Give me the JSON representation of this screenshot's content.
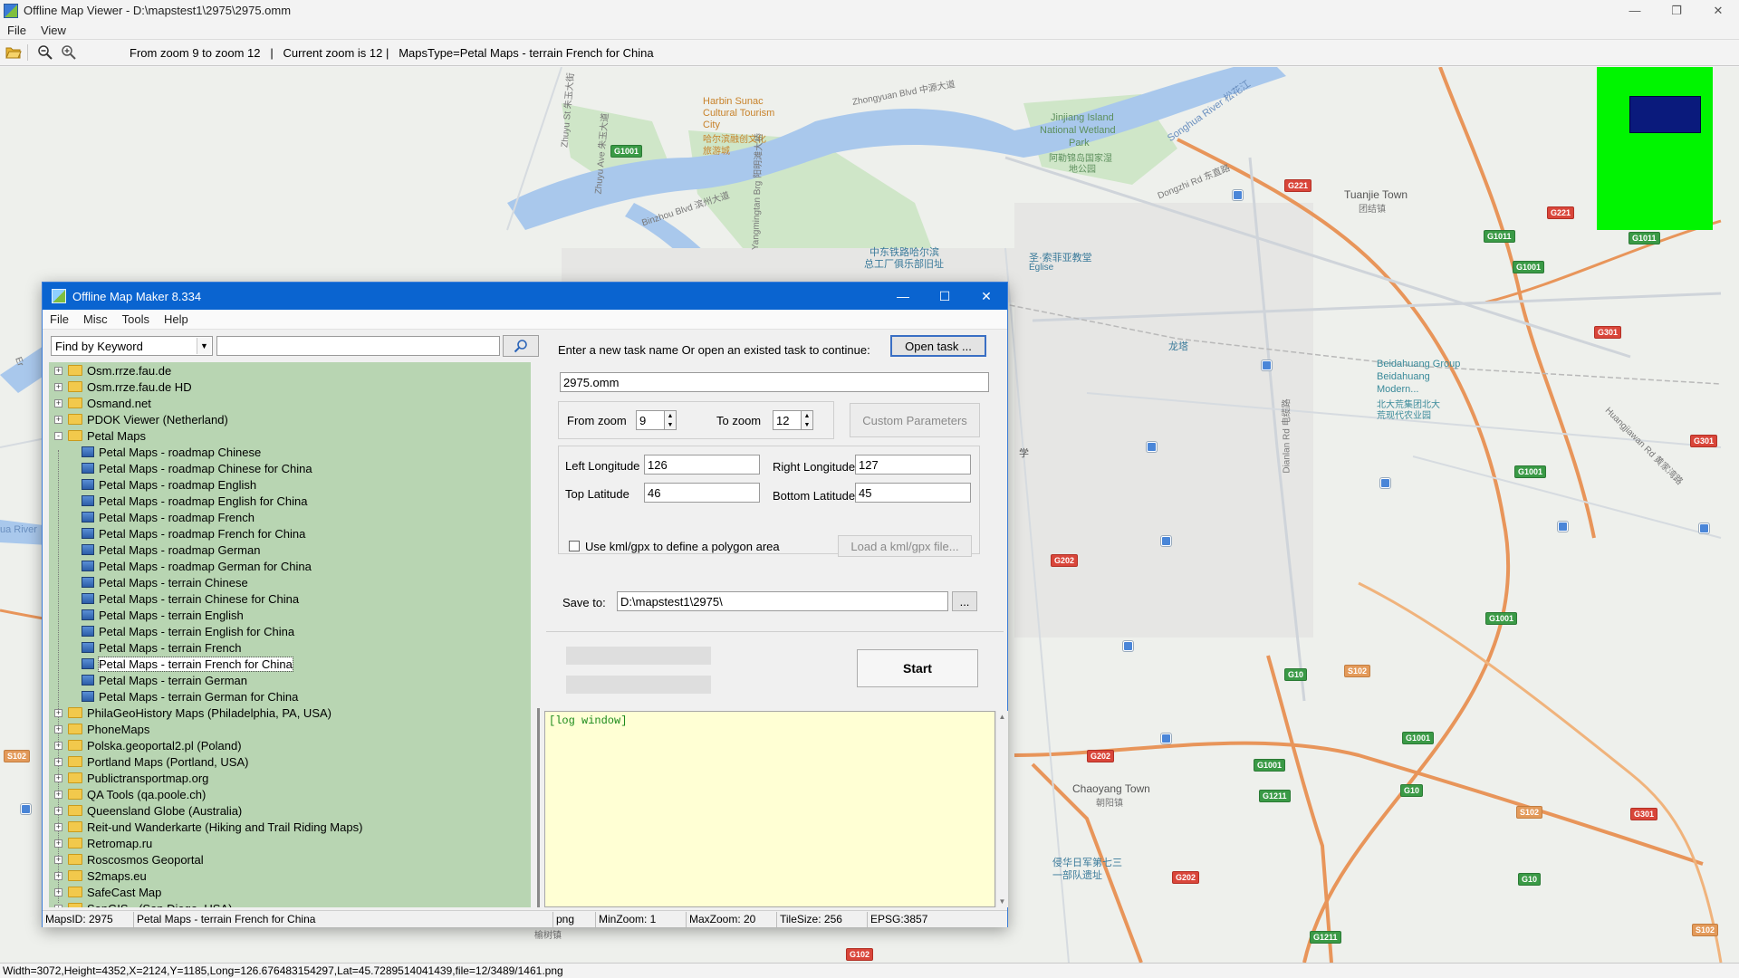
{
  "viewer": {
    "title": "Offline Map Viewer - D:\\mapstest1\\2975\\2975.omm",
    "menu": [
      "File",
      "View"
    ],
    "toolbar_status": "From zoom 9 to zoom 12   |   Current zoom is 12 |   MapsType=Petal Maps - terrain French for China",
    "statusbar": "Width=3072,Height=4352,X=2124,Y=1185,Long=126.676483154297,Lat=45.7289514041439,file=12/3489/1461.png",
    "icons": [
      "folder-open-icon",
      "zoom-out-icon",
      "zoom-in-icon"
    ]
  },
  "map": {
    "labels": [
      {
        "text": "Harbin Sunac",
        "color": "#c8822a"
      },
      {
        "text": "Cultural Tourism",
        "color": "#c8822a"
      },
      {
        "text": "City",
        "color": "#c8822a"
      },
      {
        "text": "哈尔滨融创文化",
        "color": "#c8822a"
      },
      {
        "text": "旅游城",
        "color": "#c8822a"
      },
      {
        "text": "Jinjiang Island",
        "color": "#5c8f5c"
      },
      {
        "text": "National Wetland",
        "color": "#5c8f5c"
      },
      {
        "text": "Park",
        "color": "#5c8f5c"
      },
      {
        "text": "阿勒锦岛国家湿",
        "color": "#5c8f5c"
      },
      {
        "text": "地公园",
        "color": "#5c8f5c"
      },
      {
        "text": "Songhua River 松花江",
        "color": "#6a8fbf"
      },
      {
        "text": "Zhongyuan Blvd 中源大道",
        "color": "#777777"
      },
      {
        "text": "Zhuyu St 朱玉大街",
        "color": "#777777"
      },
      {
        "text": "Zhuyu Ave 朱玉大道",
        "color": "#777777"
      },
      {
        "text": "Binzhou Blvd 滨州大道",
        "color": "#777777"
      },
      {
        "text": "Yangmingtan Brg 阳明滩大桥",
        "color": "#777777"
      },
      {
        "text": "中东铁路哈尔滨",
        "color": "#3a7a9a"
      },
      {
        "text": "总工厂俱乐部旧址",
        "color": "#3a7a9a"
      },
      {
        "text": "圣·索菲亚教堂",
        "color": "#3a7a9a"
      },
      {
        "text": "Église",
        "color": "#3a7a9a"
      },
      {
        "text": "Dongzhi Rd 东直路",
        "color": "#777777"
      },
      {
        "text": "Tuanjie Town",
        "color": "#555555"
      },
      {
        "text": "团结镇",
        "color": "#777777"
      },
      {
        "text": "龙塔",
        "color": "#3a7a9a"
      },
      {
        "text": "Beidahuang Group",
        "color": "#3a8a9a"
      },
      {
        "text": "Beidahuang",
        "color": "#3a8a9a"
      },
      {
        "text": "Modern...",
        "color": "#3a8a9a"
      },
      {
        "text": "北大荒集团北大",
        "color": "#3a8a9a"
      },
      {
        "text": "荒现代农业园",
        "color": "#3a8a9a"
      },
      {
        "text": "Chaoyang Town",
        "color": "#555555"
      },
      {
        "text": "朝阳镇",
        "color": "#777777"
      },
      {
        "text": "侵华日军第七三",
        "color": "#3a7a9a"
      },
      {
        "text": "一部队遗址",
        "color": "#3a7a9a"
      },
      {
        "text": "Dianlan Rd 电缆路",
        "color": "#777777"
      },
      {
        "text": "Huangjiawan Rd 黄家湾路",
        "color": "#777777"
      },
      {
        "text": "ua River",
        "color": "#6a8fbf"
      },
      {
        "text": "Er",
        "color": "#777777"
      },
      {
        "text": "学",
        "color": "#555555"
      },
      {
        "text": "榆树镇",
        "color": "#777777"
      }
    ],
    "badges": [
      {
        "text": "G1001",
        "kind": "green"
      },
      {
        "text": "G1011",
        "kind": "green"
      },
      {
        "text": "G1011",
        "kind": "green"
      },
      {
        "text": "G1001",
        "kind": "green"
      },
      {
        "text": "G221",
        "kind": "g"
      },
      {
        "text": "G221",
        "kind": "g"
      },
      {
        "text": "G301",
        "kind": "g"
      },
      {
        "text": "G1001",
        "kind": "green"
      },
      {
        "text": "G301",
        "kind": "g"
      },
      {
        "text": "G202",
        "kind": "g"
      },
      {
        "text": "G1001",
        "kind": "green"
      },
      {
        "text": "G10",
        "kind": "green"
      },
      {
        "text": "S102",
        "kind": "s"
      },
      {
        "text": "G202",
        "kind": "g"
      },
      {
        "text": "G1001",
        "kind": "green"
      },
      {
        "text": "G1001",
        "kind": "green"
      },
      {
        "text": "G1211",
        "kind": "green"
      },
      {
        "text": "G10",
        "kind": "green"
      },
      {
        "text": "S102",
        "kind": "s"
      },
      {
        "text": "G301",
        "kind": "g"
      },
      {
        "text": "G202",
        "kind": "g"
      },
      {
        "text": "G10",
        "kind": "green"
      },
      {
        "text": "G1211",
        "kind": "green"
      },
      {
        "text": "S102",
        "kind": "s"
      },
      {
        "text": "S102",
        "kind": "s"
      },
      {
        "text": "G102",
        "kind": "g"
      }
    ]
  },
  "dialog": {
    "title": "Offline Map Maker 8.334",
    "menu": [
      "File",
      "Misc",
      "Tools",
      "Help"
    ],
    "find_select": "Find by Keyword",
    "search_value": "",
    "tree": [
      {
        "label": "Osm.rrze.fau.de",
        "type": "folder",
        "level": 0,
        "expander": "+"
      },
      {
        "label": "Osm.rrze.fau.de HD",
        "type": "folder",
        "level": 0,
        "expander": "+"
      },
      {
        "label": "Osmand.net",
        "type": "folder",
        "level": 0,
        "expander": "+"
      },
      {
        "label": "PDOK Viewer (Netherland)",
        "type": "folder",
        "level": 0,
        "expander": "+"
      },
      {
        "label": "Petal Maps",
        "type": "folder-open",
        "level": 0,
        "expander": "-"
      },
      {
        "label": "Petal Maps - roadmap Chinese",
        "type": "map",
        "level": 1
      },
      {
        "label": "Petal Maps - roadmap Chinese for China",
        "type": "map",
        "level": 1
      },
      {
        "label": "Petal Maps - roadmap English",
        "type": "map",
        "level": 1
      },
      {
        "label": "Petal Maps - roadmap English for China",
        "type": "map",
        "level": 1
      },
      {
        "label": "Petal Maps - roadmap French",
        "type": "map",
        "level": 1
      },
      {
        "label": "Petal Maps - roadmap French for China",
        "type": "map",
        "level": 1
      },
      {
        "label": "Petal Maps - roadmap German",
        "type": "map",
        "level": 1
      },
      {
        "label": "Petal Maps - roadmap German for China",
        "type": "map",
        "level": 1
      },
      {
        "label": "Petal Maps - terrain Chinese",
        "type": "map",
        "level": 1
      },
      {
        "label": "Petal Maps - terrain Chinese for China",
        "type": "map",
        "level": 1
      },
      {
        "label": "Petal Maps - terrain English",
        "type": "map",
        "level": 1
      },
      {
        "label": "Petal Maps - terrain English for China",
        "type": "map",
        "level": 1
      },
      {
        "label": "Petal Maps - terrain French",
        "type": "map",
        "level": 1
      },
      {
        "label": "Petal Maps - terrain French for China",
        "type": "map",
        "level": 1,
        "selected": true
      },
      {
        "label": "Petal Maps - terrain German",
        "type": "map",
        "level": 1
      },
      {
        "label": "Petal Maps - terrain German for China",
        "type": "map",
        "level": 1
      },
      {
        "label": "PhilaGeoHistory Maps (Philadelphia, PA, USA)",
        "type": "folder",
        "level": 0,
        "expander": "+"
      },
      {
        "label": "PhoneMaps",
        "type": "folder",
        "level": 0,
        "expander": "+"
      },
      {
        "label": "Polska.geoportal2.pl (Poland)",
        "type": "folder",
        "level": 0,
        "expander": "+"
      },
      {
        "label": "Portland Maps (Portland, USA)",
        "type": "folder",
        "level": 0,
        "expander": "+"
      },
      {
        "label": "Publictransportmap.org",
        "type": "folder",
        "level": 0,
        "expander": "+"
      },
      {
        "label": "QA Tools (qa.poole.ch)",
        "type": "folder",
        "level": 0,
        "expander": "+"
      },
      {
        "label": "Queensland Globe (Australia)",
        "type": "folder",
        "level": 0,
        "expander": "+"
      },
      {
        "label": "Reit-und Wanderkarte (Hiking and Trail Riding Maps)",
        "type": "folder",
        "level": 0,
        "expander": "+"
      },
      {
        "label": "Retromap.ru",
        "type": "folder",
        "level": 0,
        "expander": "+"
      },
      {
        "label": "Roscosmos Geoportal",
        "type": "folder",
        "level": 0,
        "expander": "+"
      },
      {
        "label": "S2maps.eu",
        "type": "folder",
        "level": 0,
        "expander": "+"
      },
      {
        "label": "SafeCast Map",
        "type": "folder",
        "level": 0,
        "expander": "+"
      },
      {
        "label": "SanGIS - (San Diego, USA)",
        "type": "folder",
        "level": 0,
        "expander": "+"
      }
    ],
    "task_prompt": "Enter a new task name Or open an existed task to continue:",
    "open_task_label": "Open task ...",
    "task_name": "2975.omm",
    "from_zoom_label": "From zoom",
    "from_zoom": "9",
    "to_zoom_label": "To zoom",
    "to_zoom": "12",
    "custom_params_label": "Custom Parameters",
    "left_lon_label": "Left Longitude",
    "left_lon": "126",
    "right_lon_label": "Right Longitude",
    "right_lon": "127",
    "top_lat_label": "Top Latitude",
    "top_lat": "46",
    "bottom_lat_label": "Bottom Latitude",
    "bottom_lat": "45",
    "kml_checkbox_label": "Use kml/gpx to define a polygon area",
    "kml_checked": false,
    "load_kml_label": "Load a kml/gpx file...",
    "save_to_label": "Save to:",
    "save_to": "D:\\mapstest1\\2975\\",
    "browse_label": "...",
    "start_label": "Start",
    "log_text": "[log window]",
    "status": {
      "maps_id": "MapsID: 2975",
      "maps_name": "Petal Maps - terrain French for China",
      "format": "png",
      "min_zoom": "MinZoom: 1",
      "max_zoom": "MaxZoom: 20",
      "tile_size": "TileSize: 256",
      "epsg": "EPSG:3857"
    }
  }
}
